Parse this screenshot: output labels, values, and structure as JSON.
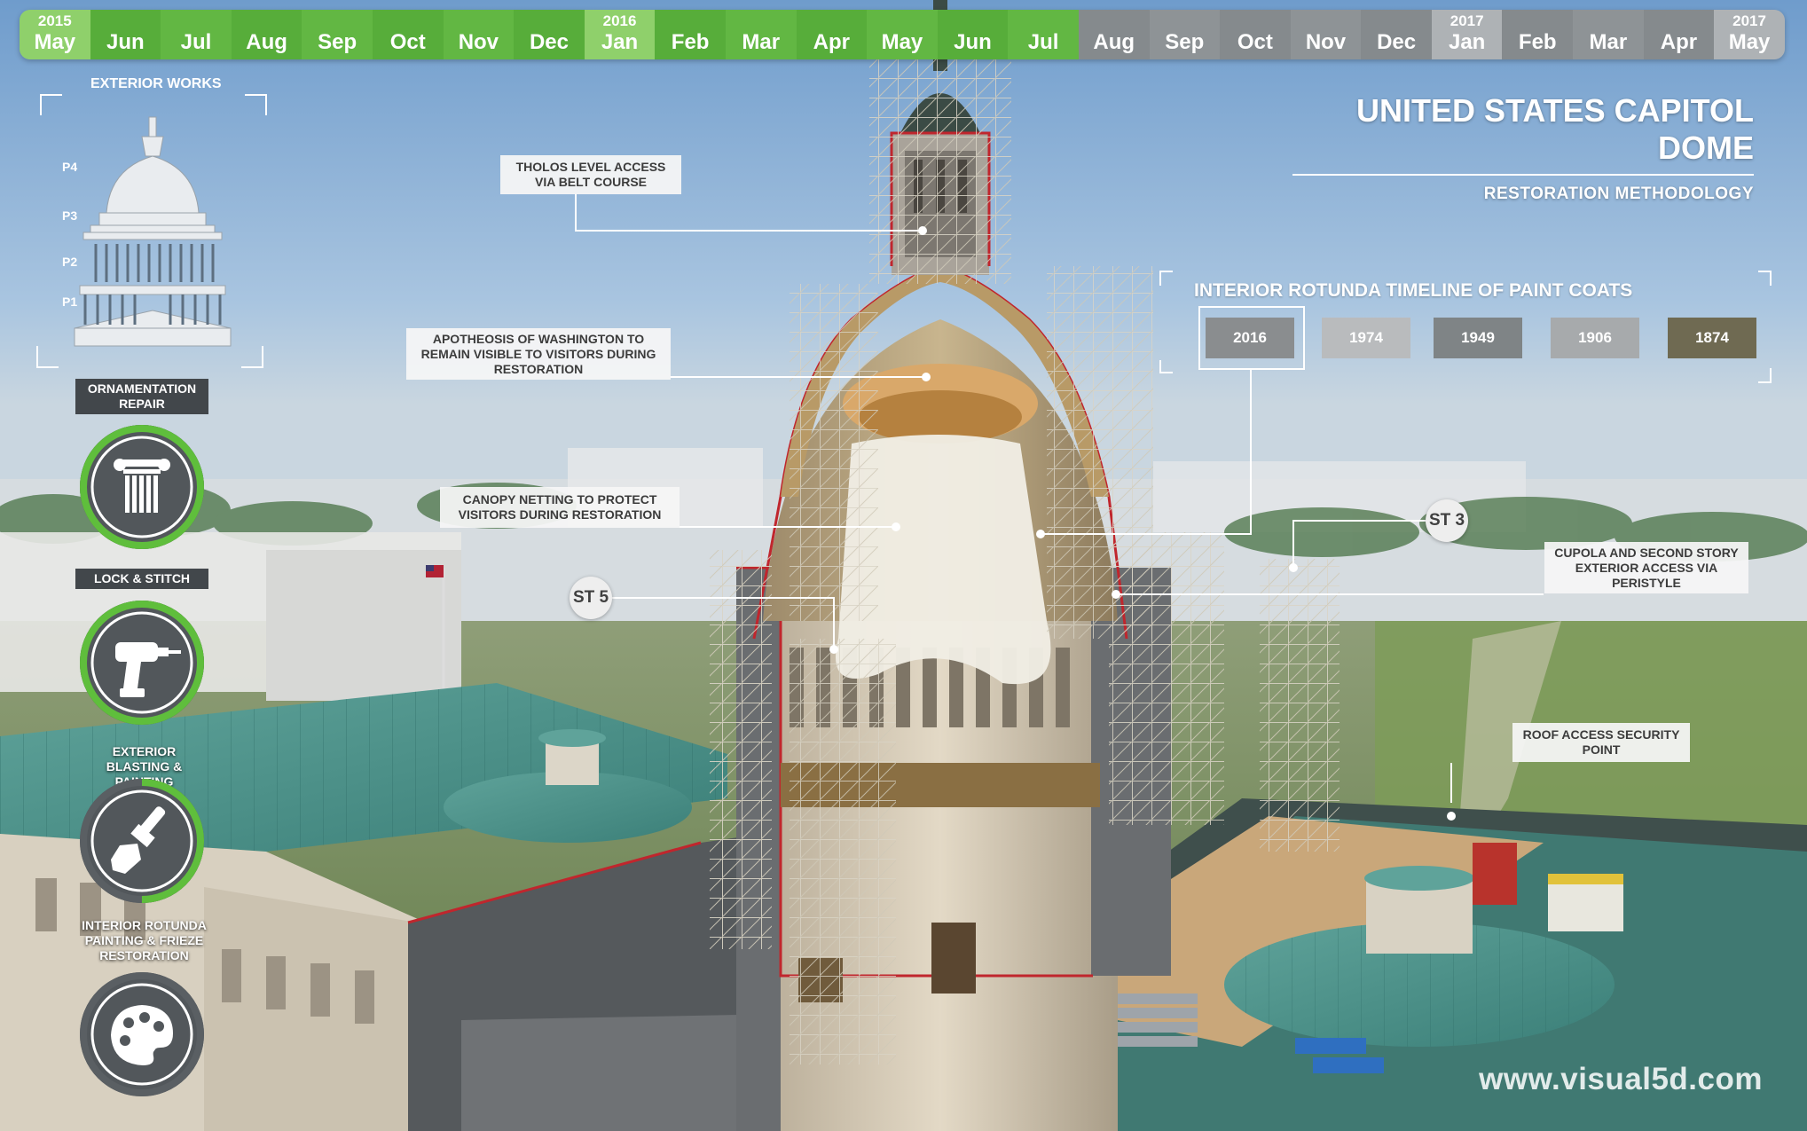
{
  "timeline": {
    "months": [
      {
        "label": "May",
        "year": "2015",
        "status": "done"
      },
      {
        "label": "Jun",
        "year": "",
        "status": "done"
      },
      {
        "label": "Jul",
        "year": "",
        "status": "done"
      },
      {
        "label": "Aug",
        "year": "",
        "status": "done"
      },
      {
        "label": "Sep",
        "year": "",
        "status": "done"
      },
      {
        "label": "Oct",
        "year": "",
        "status": "done"
      },
      {
        "label": "Nov",
        "year": "",
        "status": "done"
      },
      {
        "label": "Dec",
        "year": "",
        "status": "done"
      },
      {
        "label": "Jan",
        "year": "2016",
        "status": "done"
      },
      {
        "label": "Feb",
        "year": "",
        "status": "done"
      },
      {
        "label": "Mar",
        "year": "",
        "status": "done"
      },
      {
        "label": "Apr",
        "year": "",
        "status": "done"
      },
      {
        "label": "May",
        "year": "",
        "status": "done"
      },
      {
        "label": "Jun",
        "year": "",
        "status": "done"
      },
      {
        "label": "Jul",
        "year": "",
        "status": "done"
      },
      {
        "label": "Aug",
        "year": "",
        "status": "todo"
      },
      {
        "label": "Sep",
        "year": "",
        "status": "todo"
      },
      {
        "label": "Oct",
        "year": "",
        "status": "todo"
      },
      {
        "label": "Nov",
        "year": "",
        "status": "todo"
      },
      {
        "label": "Dec",
        "year": "",
        "status": "todo"
      },
      {
        "label": "Jan",
        "year": "2017",
        "status": "todo"
      },
      {
        "label": "Feb",
        "year": "",
        "status": "todo"
      },
      {
        "label": "Mar",
        "year": "",
        "status": "todo"
      },
      {
        "label": "Apr",
        "year": "",
        "status": "todo"
      },
      {
        "label": "May",
        "year": "2017",
        "status": "todo"
      }
    ],
    "colors": {
      "done": "#62b743",
      "todo": "#8e9396"
    }
  },
  "title": {
    "main": "UNITED STATES CAPITOL DOME",
    "sub": "RESTORATION METHODOLOGY"
  },
  "callouts": {
    "tholos": "THOLOS LEVEL  ACCESS VIA BELT COURSE",
    "apotheosis": "APOTHEOSIS OF WASHINGTON TO REMAIN VISIBLE TO VISITORS DURING RESTORATION",
    "canopy": "CANOPY NETTING TO PROTECT VISITORS DURING RESTORATION",
    "cupola": "CUPOLA AND SECOND STORY EXTERIOR ACCESS VIA PERISTYLE",
    "roof": "ROOF ACCESS SECURITY POINT",
    "st3": "ST 3",
    "st5": "ST 5"
  },
  "paint_timeline": {
    "title": "INTERIOR ROTUNDA TIMELINE OF PAINT COATS",
    "coats": [
      {
        "year": "2016",
        "color": "#8a8d8f",
        "selected": true
      },
      {
        "year": "1974",
        "color": "#b9bbbd",
        "selected": false
      },
      {
        "year": "1949",
        "color": "#7f8486",
        "selected": false
      },
      {
        "year": "1906",
        "color": "#a7aaac",
        "selected": false
      },
      {
        "year": "1874",
        "color": "#6f6a52",
        "selected": false
      }
    ]
  },
  "left_panel": {
    "title": "EXTERIOR WORKS",
    "levels": [
      "P4",
      "P3",
      "P2",
      "P1"
    ],
    "categories": [
      {
        "label": "ORNAMENTATION REPAIR",
        "icon": "column-icon",
        "progress": 1.0
      },
      {
        "label": "LOCK & STITCH",
        "icon": "drill-icon",
        "progress": 1.0
      },
      {
        "label": "EXTERIOR BLASTING & PAINTING",
        "icon": "paintbrush-icon",
        "progress": 0.5
      },
      {
        "label": "INTERIOR ROTUNDA PAINTING & FRIEZE RESTORATION",
        "icon": "palette-icon",
        "progress": 0.0
      }
    ],
    "ring_colors": {
      "done": "#5fbe3c",
      "track": "#5a5f63"
    }
  },
  "watermark": "www.visual5d.com"
}
